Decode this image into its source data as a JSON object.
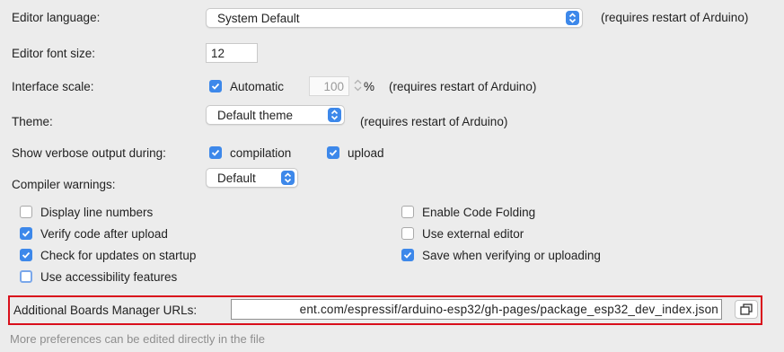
{
  "editor_language": {
    "label": "Editor language:",
    "value": "System Default",
    "note": "(requires restart of Arduino)"
  },
  "editor_font_size": {
    "label": "Editor font size:",
    "value": "12"
  },
  "interface_scale": {
    "label": "Interface scale:",
    "automatic_label": "Automatic",
    "automatic_checked": true,
    "scale_value": "100",
    "unit": "%",
    "note": "(requires restart of Arduino)"
  },
  "theme": {
    "label": "Theme:",
    "value": "Default theme",
    "note": "(requires restart of Arduino)"
  },
  "verbose_output": {
    "label": "Show verbose output during:",
    "compilation_label": "compilation",
    "compilation_checked": true,
    "upload_label": "upload",
    "upload_checked": true
  },
  "compiler_warnings": {
    "label": "Compiler warnings:",
    "value": "Default"
  },
  "options": {
    "display_line_numbers": {
      "label": "Display line numbers",
      "checked": false
    },
    "verify_after_upload": {
      "label": "Verify code after upload",
      "checked": true
    },
    "check_updates": {
      "label": "Check for updates on startup",
      "checked": true
    },
    "accessibility": {
      "label": "Use accessibility features",
      "checked": false
    },
    "code_folding": {
      "label": "Enable Code Folding",
      "checked": false
    },
    "external_editor": {
      "label": "Use external editor",
      "checked": false
    },
    "save_when_verifying": {
      "label": "Save when verifying or uploading",
      "checked": true
    }
  },
  "boards_manager": {
    "label": "Additional Boards Manager URLs:",
    "value": "ent.com/espressif/arduino-esp32/gh-pages/package_esp32_dev_index.json",
    "button_icon": "window-stack-icon",
    "highlight_color": "#d90f1b"
  },
  "footer_text": "More preferences can be edited directly in the file",
  "colors": {
    "accent": "#3d88ea",
    "background": "#ececec"
  }
}
